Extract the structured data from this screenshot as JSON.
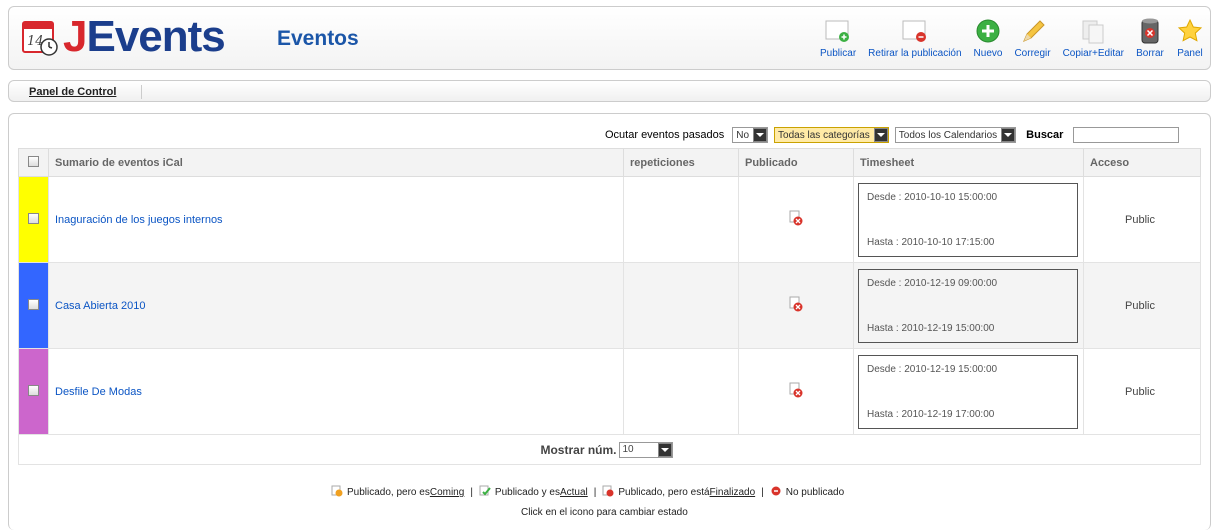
{
  "header": {
    "logo_j": "J",
    "logo_rest": "Events",
    "calendar_day": "14",
    "title": "Eventos"
  },
  "toolbar": [
    {
      "label": "Publicar",
      "icon": "publish-icon"
    },
    {
      "label": "Retirar la publicación",
      "icon": "unpublish-icon"
    },
    {
      "label": "Nuevo",
      "icon": "new-icon"
    },
    {
      "label": "Corregir",
      "icon": "edit-icon"
    },
    {
      "label": "Copiar+Editar",
      "icon": "copy-icon"
    },
    {
      "label": "Borrar",
      "icon": "trash-icon"
    },
    {
      "label": "Panel",
      "icon": "star-icon"
    }
  ],
  "submenu": {
    "panel_label": "Panel de Control"
  },
  "filters": {
    "past_label": "Ocutar eventos pasados",
    "past_value": "No",
    "category_value": "Todas las categorías",
    "calendar_value": "Todos los Calendarios",
    "search_label": "Buscar",
    "search_value": ""
  },
  "table": {
    "headers": [
      "Sumario de eventos iCal",
      "repeticiones",
      "Publicado",
      "Timesheet",
      "Acceso"
    ],
    "rows": [
      {
        "color": "#ffff00",
        "title": "Inaguración de los juegos internos",
        "repeats": "",
        "from": "Desde : 2010-10-10 15:00:00",
        "to": "Hasta : 2010-10-10 17:15:00",
        "access": "Public"
      },
      {
        "color": "#3366ff",
        "title": "Casa Abierta 2010",
        "repeats": "",
        "from": "Desde : 2010-12-19 09:00:00",
        "to": "Hasta : 2010-12-19 15:00:00",
        "access": "Public"
      },
      {
        "color": "#cc66cc",
        "title": "Desfile De Modas",
        "repeats": "",
        "from": "Desde : 2010-12-19 15:00:00",
        "to": "Hasta : 2010-12-19 17:00:00",
        "access": "Public"
      }
    ]
  },
  "pagination": {
    "label": "Mostrar núm.",
    "value": "10"
  },
  "legend": {
    "coming_prefix": "Publicado, pero es ",
    "coming": "Coming",
    "current_prefix": "Publicado y es ",
    "current": "Actual",
    "finished_prefix": "Publicado, pero está ",
    "finished": "Finalizado",
    "unpublished": "No publicado",
    "sep": "|"
  },
  "hint": "Click en el icono para cambiar estado"
}
